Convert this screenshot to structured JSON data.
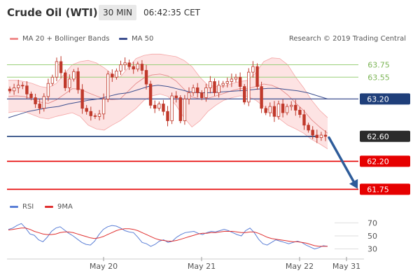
{
  "header": {
    "title": "Crude Oil (WTI)",
    "timeframe": "30 MIN",
    "time": "06:42:35 CET"
  },
  "legend": {
    "ma20": "MA 20 + Bollinger Bands",
    "ma50": "MA 50",
    "credit": "Research © 2019 Trading Central"
  },
  "rsi_legend": {
    "rsi": "RSI",
    "ma9": "9MA"
  },
  "colors": {
    "candle": "#c0392b",
    "band_fill": "#fde3e3",
    "band_line": "#f4a6a6",
    "ma50": "#3d4f8f",
    "support": "#e60000",
    "pivot": "#1f3f7a",
    "resistance": "#9ad07a",
    "arrow": "#2e5c9a",
    "rsi": "#5b7fd6",
    "rsi_ma": "#e03030"
  },
  "chart_data": [
    {
      "type": "line",
      "title": "Crude Oil (WTI) 30 MIN",
      "ylim": [
        61.62,
        63.98
      ],
      "x": [
        "May 20",
        "May 21",
        "May 22",
        "May 31"
      ],
      "series": [
        {
          "name": "MA 20 + Bollinger Bands"
        },
        {
          "name": "MA 50"
        }
      ],
      "price_path": [
        63.33,
        63.38,
        63.42,
        63.41,
        63.28,
        63.22,
        63.12,
        63.05,
        63.24,
        63.45,
        63.55,
        63.8,
        63.62,
        63.38,
        63.52,
        63.64,
        63.35,
        63.05,
        63.0,
        62.93,
        62.92,
        62.96,
        63.2,
        63.6,
        63.55,
        63.65,
        63.75,
        63.78,
        63.72,
        63.68,
        63.76,
        63.66,
        63.44,
        63.1,
        63.05,
        63.12,
        63.0,
        62.85,
        63.25,
        63.22,
        62.85,
        63.2,
        63.3,
        63.38,
        63.3,
        63.22,
        63.38,
        63.48,
        63.3,
        63.42,
        63.45,
        63.48,
        63.52,
        63.55,
        63.4,
        63.15,
        63.63,
        63.72,
        63.4,
        63.05,
        62.98,
        63.08,
        62.92,
        63.12,
        62.98,
        63.08,
        63.1,
        63.02,
        62.95,
        62.78,
        62.7,
        62.62,
        62.58,
        62.62,
        62.6
      ],
      "bollinger_upper": [
        63.5,
        63.5,
        63.48,
        63.45,
        63.4,
        63.38,
        63.45,
        63.6,
        63.75,
        63.8,
        63.82,
        63.78,
        63.7,
        63.6,
        63.55,
        63.7,
        63.85,
        63.9,
        63.92,
        63.92,
        63.9,
        63.88,
        63.82,
        63.72,
        63.55,
        63.42,
        63.4,
        63.4,
        63.45,
        63.48,
        63.5,
        63.62,
        63.8,
        63.86,
        63.85,
        63.75,
        63.55,
        63.38,
        63.18,
        63.02,
        62.9
      ],
      "bollinger_lower": [
        62.98,
        63.0,
        63.0,
        62.95,
        62.9,
        62.88,
        62.92,
        62.95,
        62.98,
        62.92,
        62.78,
        62.72,
        62.7,
        62.78,
        62.85,
        62.95,
        63.05,
        63.18,
        63.25,
        63.28,
        63.24,
        63.1,
        62.9,
        62.75,
        62.85,
        63.0,
        63.1,
        63.18,
        63.22,
        63.25,
        63.24,
        63.18,
        63.08,
        62.98,
        62.88,
        62.78,
        62.72,
        62.65,
        62.55,
        62.48,
        62.4
      ],
      "ma50": [
        62.9,
        62.95,
        63.0,
        63.03,
        63.06,
        63.08,
        63.12,
        63.15,
        63.18,
        63.2,
        63.24,
        63.28,
        63.3,
        63.35,
        63.4,
        63.42,
        63.4,
        63.36,
        63.32,
        63.3,
        63.3,
        63.31,
        63.32,
        63.33,
        63.34,
        63.36,
        63.37,
        63.37,
        63.35,
        63.33,
        63.3,
        63.25,
        63.2
      ],
      "levels": [
        {
          "label": "63.75",
          "value": 63.75,
          "kind": "resistance"
        },
        {
          "label": "63.55",
          "value": 63.55,
          "kind": "resistance"
        },
        {
          "label": "63.20",
          "value": 63.2,
          "kind": "pivot"
        },
        {
          "label": "62.60",
          "value": 62.6,
          "kind": "last"
        },
        {
          "label": "62.20",
          "value": 62.2,
          "kind": "support"
        },
        {
          "label": "61.75",
          "value": 61.75,
          "kind": "support"
        }
      ],
      "projection": {
        "from": 62.58,
        "to": 61.75
      },
      "grid": false
    },
    {
      "type": "line",
      "ylim": [
        20,
        80
      ],
      "yticks": [
        "70",
        "50",
        "30"
      ],
      "series": [
        {
          "name": "RSI",
          "values": [
            60,
            62,
            66,
            69,
            62,
            53,
            51,
            44,
            41,
            48,
            57,
            62,
            64,
            59,
            54,
            50,
            45,
            40,
            37,
            36,
            42,
            52,
            60,
            64,
            66,
            65,
            62,
            58,
            56,
            55,
            48,
            40,
            38,
            34,
            37,
            42,
            44,
            40,
            42,
            48,
            52,
            55,
            56,
            57,
            54,
            52,
            55,
            57,
            56,
            58,
            60,
            58,
            55,
            52,
            50,
            58,
            62,
            55,
            45,
            38,
            36,
            40,
            44,
            42,
            40,
            38,
            40,
            42,
            40,
            36,
            33,
            30,
            32,
            35,
            34
          ]
        },
        {
          "name": "9MA",
          "values": [
            59,
            60,
            61,
            62,
            62,
            60,
            57,
            55,
            53,
            52,
            52,
            53,
            55,
            56,
            56,
            55,
            53,
            51,
            49,
            47,
            46,
            47,
            49,
            52,
            55,
            58,
            60,
            61,
            61,
            60,
            58,
            55,
            52,
            49,
            46,
            44,
            43,
            42,
            42,
            43,
            45,
            47,
            49,
            51,
            53,
            54,
            54,
            55,
            55,
            56,
            57,
            57,
            57,
            56,
            55,
            55,
            56,
            56,
            54,
            51,
            48,
            46,
            45,
            44,
            43,
            42,
            41,
            41,
            40,
            39,
            37,
            35,
            34,
            34,
            34
          ]
        }
      ]
    }
  ],
  "axis": {
    "dates": [
      "May 20",
      "May 21",
      "May 22",
      "May 31"
    ]
  }
}
